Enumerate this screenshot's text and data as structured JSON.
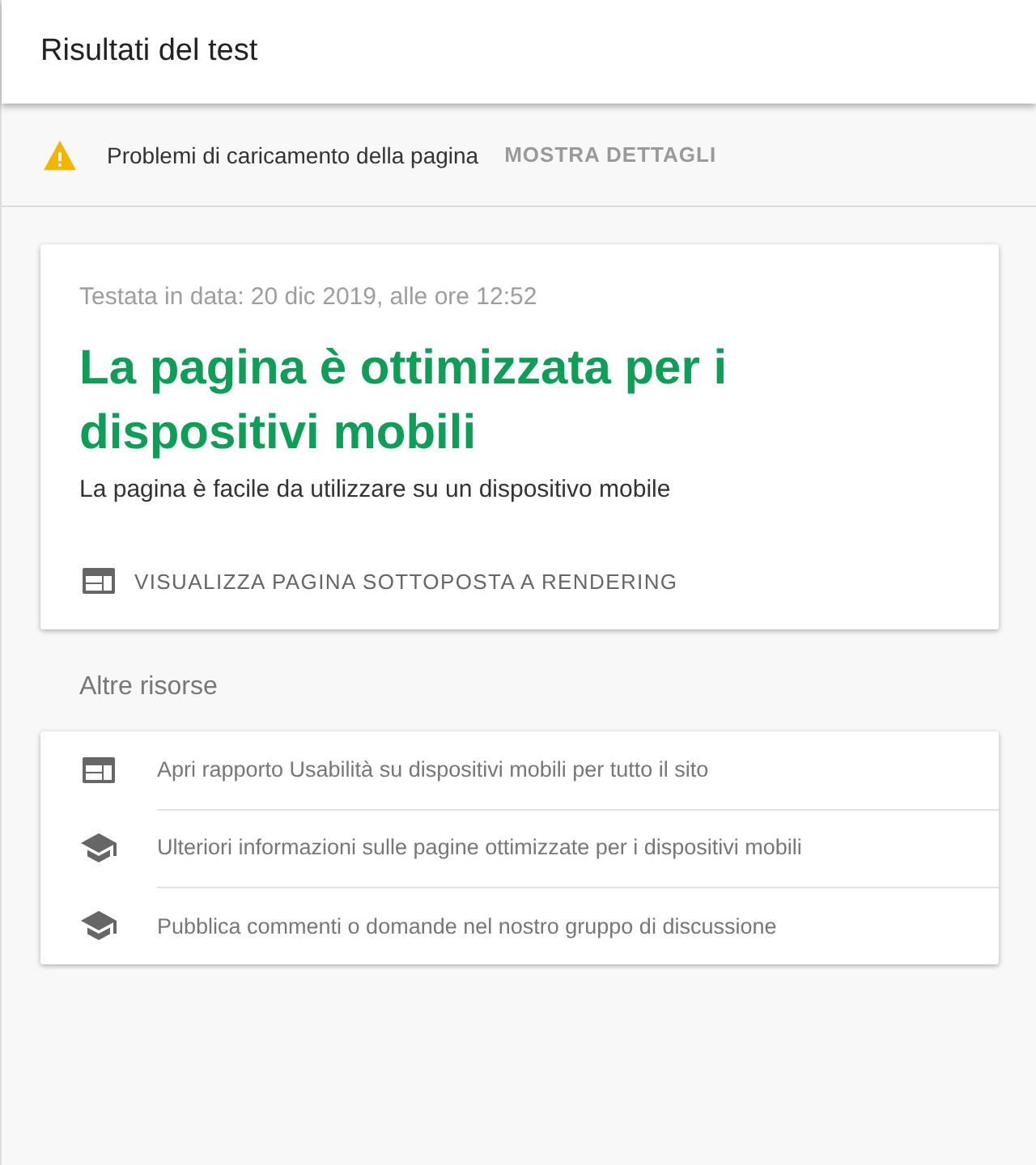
{
  "header": {
    "title": "Risultati del test"
  },
  "warning": {
    "message": "Problemi di caricamento della pagina",
    "action": "MOSTRA DETTAGLI"
  },
  "result": {
    "tested_on": "Testata in data: 20 dic 2019, alle ore 12:52",
    "verdict": "La pagina è ottimizzata per i dispositivi mobili",
    "description": "La pagina è facile da utilizzare su un dispositivo mobile",
    "action": "VISUALIZZA PAGINA SOTTOPOSTA A RENDERING"
  },
  "resources": {
    "title": "Altre risorse",
    "items": [
      {
        "kind": "report",
        "label": "Apri rapporto Usabilità su dispositivi mobili per tutto il sito"
      },
      {
        "kind": "learn",
        "label": "Ulteriori informazioni sulle pagine ottimizzate per i dispositivi mobili"
      },
      {
        "kind": "learn",
        "label": "Pubblica commenti o domande nel nostro gruppo di discussione"
      }
    ]
  }
}
